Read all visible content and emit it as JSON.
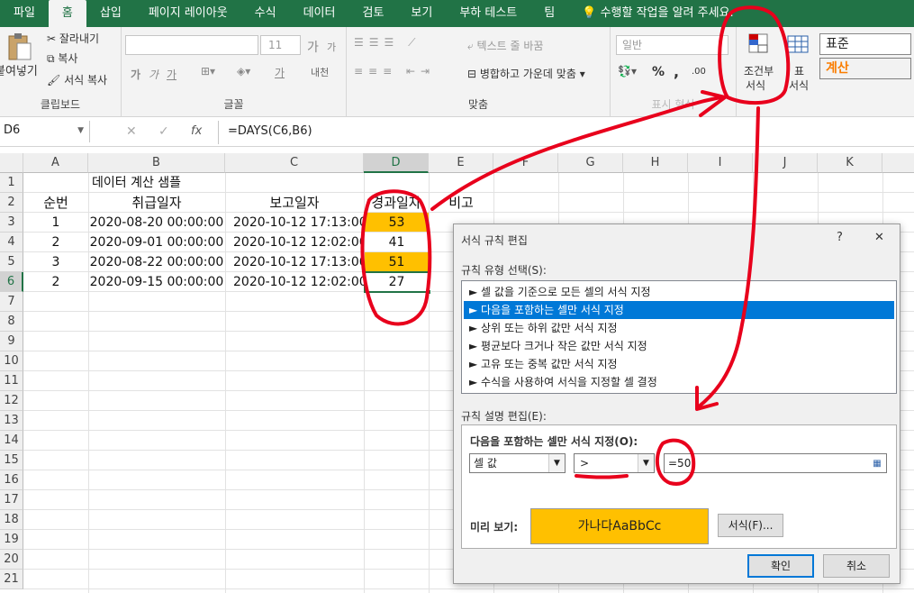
{
  "tabs": [
    "파일",
    "홈",
    "삽입",
    "페이지 레이아웃",
    "수식",
    "데이터",
    "검토",
    "보기",
    "부하 테스트",
    "팀",
    "수행할 작업을 알려 주세요."
  ],
  "ribbon": {
    "clipboard": {
      "paste": "붙여넣기",
      "cut": "잘라내기",
      "copy": "복사",
      "format_painter": "서식 복사",
      "label": "클립보드"
    },
    "font": {
      "size": "11",
      "label": "글꼴",
      "grow": "가",
      "shrink": "가",
      "bold": "가",
      "italic": "가",
      "underline": "가",
      "phonetic": "내천",
      "font_color": "가"
    },
    "alignment": {
      "wrap": "텍스트 줄 바꿈",
      "merge": "병합하고 가운데 맞춤",
      "label": "맞춤"
    },
    "number": {
      "format": "일반",
      "percent": "%",
      "comma": ",",
      "inc_dec": ".00",
      "label": "표시 형식"
    },
    "styles": {
      "cond": "조건부",
      "cond2": "서식",
      "table": "표",
      "table2": "서식",
      "normal": "표준",
      "calc": "계산"
    }
  },
  "formula_bar": {
    "name_box": "D6",
    "formula": "=DAYS(C6,B6)",
    "fx": "fx"
  },
  "columns": [
    "A",
    "B",
    "C",
    "D",
    "E",
    "F",
    "G",
    "H",
    "I",
    "J",
    "K"
  ],
  "rows": [
    "1",
    "2",
    "3",
    "4",
    "5",
    "6",
    "7",
    "8",
    "9",
    "10",
    "11",
    "12",
    "13",
    "14",
    "15",
    "16",
    "17",
    "18",
    "19",
    "20",
    "21"
  ],
  "cells": {
    "title": "데이터 계산 샘플",
    "headers": [
      "순번",
      "취급일자",
      "보고일자",
      "경과일자",
      "비고"
    ],
    "data": [
      {
        "a": "1",
        "b": "2020-08-20 00:00:00",
        "c": "2020-10-12 17:13:00",
        "d": "53"
      },
      {
        "a": "2",
        "b": "2020-09-01 00:00:00",
        "c": "2020-10-12 12:02:00",
        "d": "41"
      },
      {
        "a": "3",
        "b": "2020-08-22 00:00:00",
        "c": "2020-10-12 17:13:00",
        "d": "51"
      },
      {
        "a": "2",
        "b": "2020-09-15 00:00:00",
        "c": "2020-10-12 12:02:00",
        "d": "27"
      }
    ]
  },
  "dialog": {
    "title": "서식 규칙 편집",
    "help": "?",
    "close": "✕",
    "rule_type_label": "규칙 유형 선택(S):",
    "rule_types": [
      "► 셀 값을 기준으로 모든 셀의 서식 지정",
      "► 다음을 포함하는 셀만 서식 지정",
      "► 상위 또는 하위 값만 서식 지정",
      "► 평균보다 크거나 작은 값만 서식 지정",
      "► 고유 또는 중복 값만 서식 지정",
      "► 수식을 사용하여 서식을 지정할 셀 결정"
    ],
    "edit_label": "규칙 설명 편집(E):",
    "edit_heading": "다음을 포함하는 셀만 서식 지정(O):",
    "condition_field": "셀 값",
    "operator": ">",
    "value": "=50",
    "preview_label": "미리 보기:",
    "preview_text": "가나다AaBbCc",
    "format_button": "서식(F)...",
    "ok": "확인",
    "cancel": "취소"
  },
  "colors": {
    "excel_green": "#217346",
    "highlight": "#ffc000",
    "annotation": "#e8001c",
    "selection": "#0078d7"
  }
}
